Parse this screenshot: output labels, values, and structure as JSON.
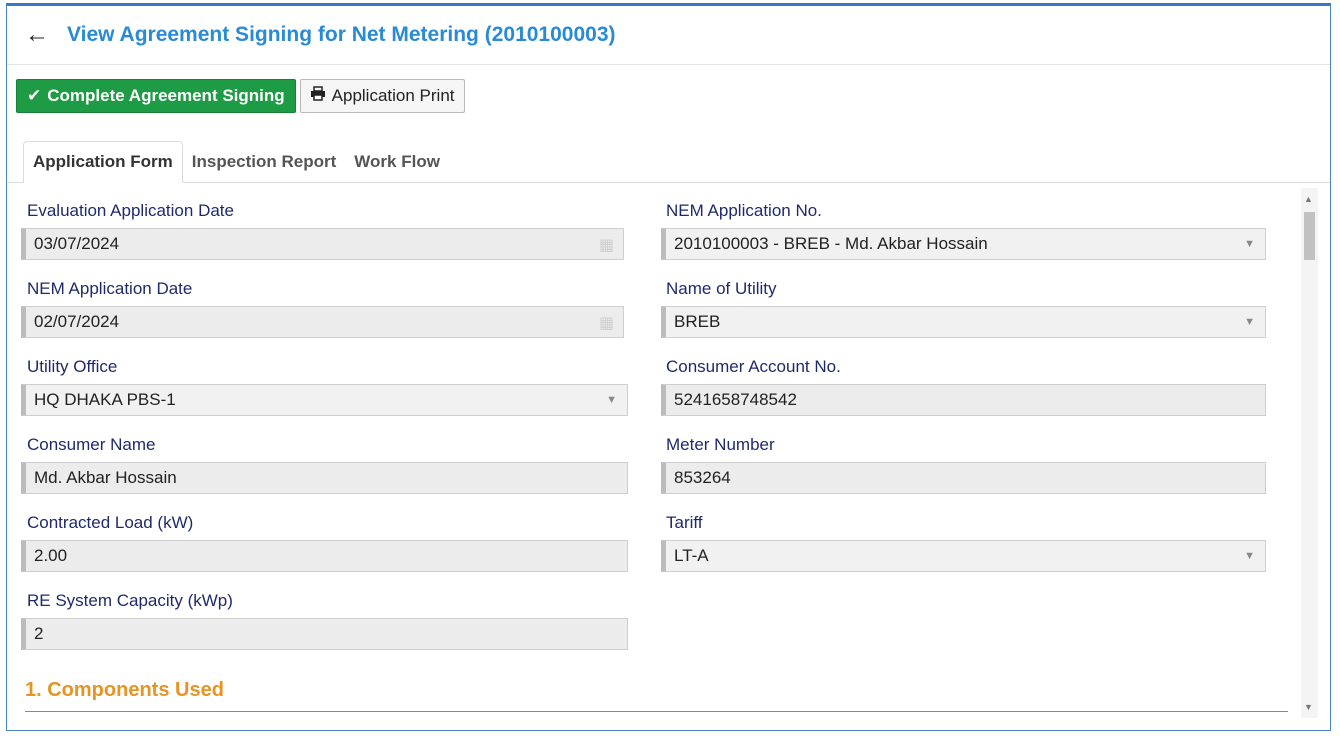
{
  "header": {
    "title": "View Agreement Signing for Net Metering (2010100003)"
  },
  "toolbar": {
    "complete_label": "Complete Agreement Signing",
    "print_label": "Application Print"
  },
  "tabs": [
    {
      "label": "Application Form"
    },
    {
      "label": "Inspection Report"
    },
    {
      "label": "Work Flow"
    }
  ],
  "form": {
    "evaluation_date": {
      "label": "Evaluation Application Date",
      "value": "03/07/2024"
    },
    "nem_app_no": {
      "label": "NEM Application No.",
      "value": "2010100003 - BREB - Md. Akbar Hossain"
    },
    "nem_app_date": {
      "label": "NEM Application Date",
      "value": "02/07/2024"
    },
    "utility_name": {
      "label": "Name of Utility",
      "value": "BREB"
    },
    "utility_office": {
      "label": "Utility Office",
      "value": "HQ DHAKA PBS-1"
    },
    "consumer_account": {
      "label": "Consumer Account No.",
      "value": "5241658748542"
    },
    "consumer_name": {
      "label": "Consumer Name",
      "value": "Md. Akbar Hossain"
    },
    "meter_number": {
      "label": "Meter Number",
      "value": "853264"
    },
    "contracted_load": {
      "label": "Contracted Load (kW)",
      "value": "2.00"
    },
    "tariff": {
      "label": "Tariff",
      "value": "LT-A"
    },
    "re_capacity": {
      "label": "RE System Capacity (kWp)",
      "value": "2"
    }
  },
  "section": {
    "title": "1. Components Used"
  }
}
